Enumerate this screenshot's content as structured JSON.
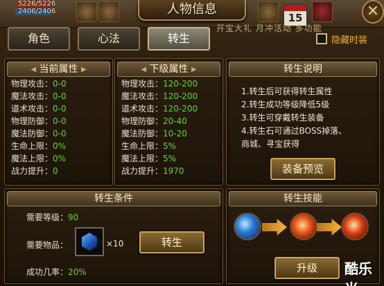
{
  "hud": {
    "hp": "5226/5226",
    "mp": "2406/2406"
  },
  "window_title": "人物信息",
  "calendar_day": "15",
  "banner_text": "开宝大礼 月冲活动 多功能",
  "tabs": [
    {
      "label": "角色",
      "active": false
    },
    {
      "label": "心法",
      "active": false
    },
    {
      "label": "转生",
      "active": true
    }
  ],
  "hide_fashion_label": "隐藏时装",
  "current_attrs": {
    "title": "当前属性",
    "rows": [
      {
        "label": "物理攻击：",
        "value": "0-0"
      },
      {
        "label": "魔法攻击：",
        "value": "0-0"
      },
      {
        "label": "道术攻击：",
        "value": "0-0"
      },
      {
        "label": "物理防御：",
        "value": "0-0"
      },
      {
        "label": "魔法防御：",
        "value": "0-0"
      },
      {
        "label": "生命上限：",
        "value": "0%"
      },
      {
        "label": "魔法上限：",
        "value": "0%"
      },
      {
        "label": "战力提升：",
        "value": "0"
      }
    ]
  },
  "next_attrs": {
    "title": "下级属性",
    "rows": [
      {
        "label": "物理攻击：",
        "value": "120-200"
      },
      {
        "label": "魔法攻击：",
        "value": "120-200"
      },
      {
        "label": "道术攻击：",
        "value": "120-200"
      },
      {
        "label": "物理防御：",
        "value": "20-40"
      },
      {
        "label": "魔法防御：",
        "value": "10-20"
      },
      {
        "label": "生命上限：",
        "value": "5%"
      },
      {
        "label": "魔法上限：",
        "value": "5%"
      },
      {
        "label": "战力提升：",
        "value": "1970"
      }
    ]
  },
  "rebirth_info": {
    "title": "转生说明",
    "lines": [
      "1.转生后可获得转生属性",
      "2.转生成功等级降低5级",
      "3.转生可穿戴转生装备",
      "4.转生石可通过BOSS掉落、",
      "商城、寻宝获得"
    ],
    "preview_button": "装备预览"
  },
  "rebirth_conditions": {
    "title": "转生条件",
    "level_label": "需要等级：",
    "level_value": "90",
    "item_label": "需要物品：",
    "item_qty": "×10",
    "item_icon": "rebirth-stone-icon",
    "rebirth_button": "转生",
    "rate_label": "成功几率：",
    "rate_value": "20%"
  },
  "rebirth_skills": {
    "title": "转生技能",
    "upgrade_button": "升级"
  },
  "watermark": "酷乐米",
  "colors": {
    "value_green": "#62d63a",
    "hide_label": "#f2b233",
    "title_gold": "#b58a4a"
  }
}
